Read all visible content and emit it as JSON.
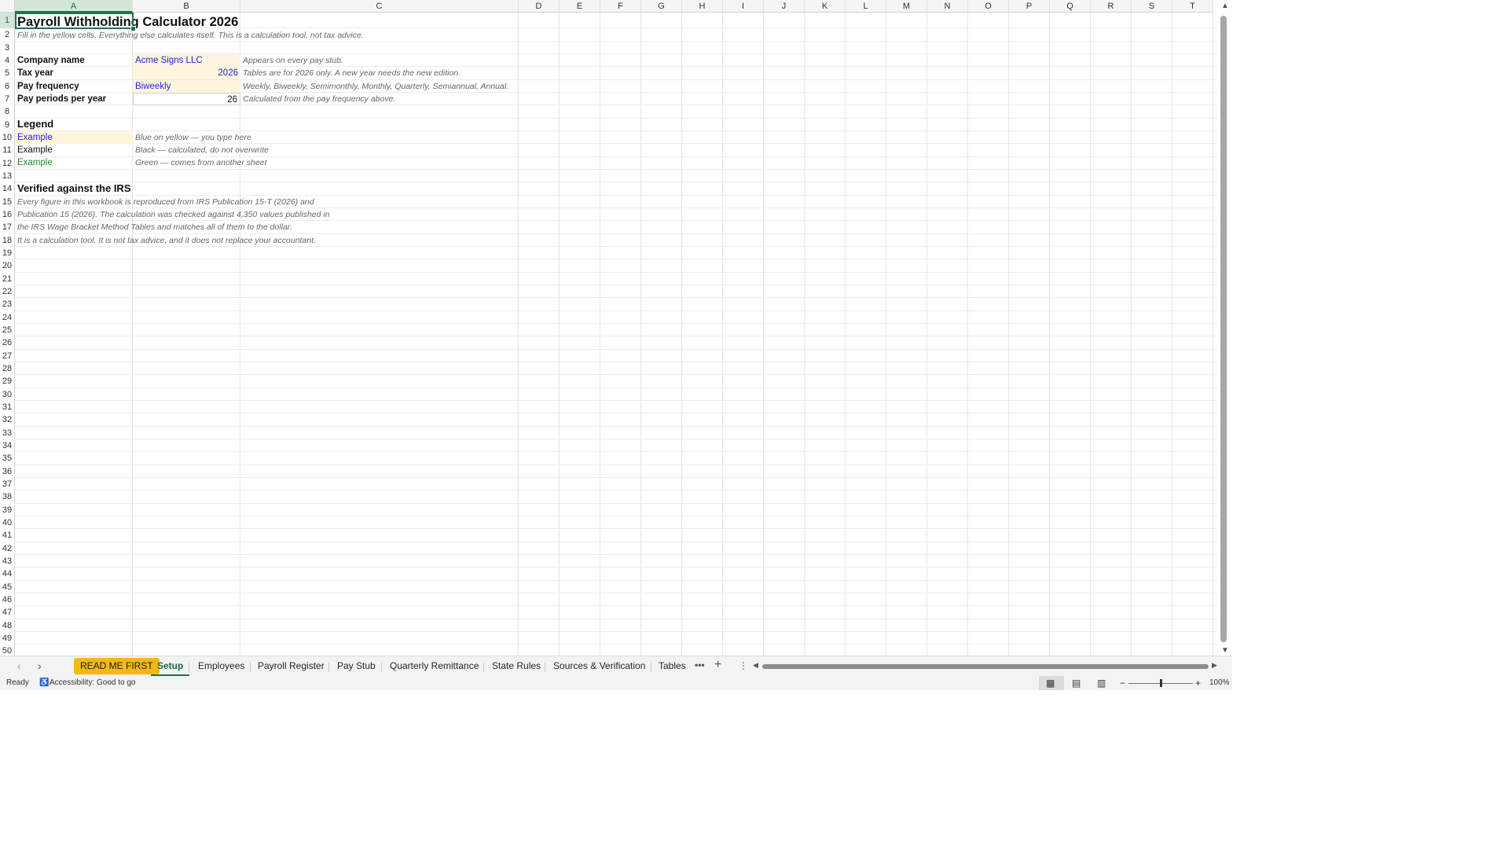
{
  "columns": [
    "A",
    "B",
    "C",
    "D",
    "E",
    "F",
    "G",
    "H",
    "I",
    "J",
    "K",
    "L",
    "M",
    "N",
    "O",
    "P",
    "Q",
    "R",
    "S",
    "T"
  ],
  "rows": [
    "1",
    "2",
    "3",
    "4",
    "5",
    "6",
    "7",
    "8",
    "9",
    "10",
    "11",
    "12",
    "13",
    "14",
    "15",
    "16",
    "17",
    "18",
    "19",
    "20",
    "21",
    "22",
    "23",
    "24",
    "25",
    "26",
    "27",
    "28",
    "29",
    "30",
    "31",
    "32",
    "33",
    "34",
    "35",
    "36",
    "37",
    "38",
    "39",
    "40",
    "41",
    "42",
    "43",
    "44",
    "45",
    "46",
    "47",
    "48",
    "49",
    "50"
  ],
  "cells": {
    "title": "Payroll Withholding Calculator 2026",
    "subtitle": "Fill in the yellow cells. Everything else calculates itself. This is a calculation tool, not tax advice.",
    "company_label": "Company name",
    "company_value": "Acme Signs LLC",
    "company_note": "Appears on every pay stub.",
    "taxyear_label": "Tax year",
    "taxyear_value": "2026",
    "taxyear_note": "Tables are for 2026 only. A new year needs the new edition.",
    "payfreq_label": "Pay frequency",
    "payfreq_value": "Biweekly",
    "payfreq_note": "Weekly, Biweekly, Semimonthly, Monthly, Quarterly, Semiannual, Annual.",
    "periods_label": "Pay periods per year",
    "periods_value": "26",
    "periods_note": "Calculated from the pay frequency above.",
    "legend_heading": "Legend",
    "legend1_example": "Example",
    "legend1_note": "Blue on yellow — you type here",
    "legend2_example": "Example",
    "legend2_note": "Black — calculated, do not overwrite",
    "legend3_example": "Example",
    "legend3_note": "Green — comes from another sheet",
    "verified_heading": "Verified against the IRS",
    "verified_line1": "Every figure in this workbook is reproduced from IRS Publication 15-T (2026) and",
    "verified_line2": "Publication 15 (2026). The calculation was checked against 4,350 values published in",
    "verified_line3": "the IRS Wage Bracket Method Tables and matches all of them to the dollar.",
    "verified_line4": "It is a calculation tool. It is not tax advice, and it does not replace your accountant."
  },
  "tabs": {
    "readme": "READ ME FIRST",
    "setup": "Setup",
    "employees": "Employees",
    "register": "Payroll Register",
    "paystub": "Pay Stub",
    "quarterly": "Quarterly Remittance",
    "staterules": "State Rules",
    "sources": "Sources & Verification",
    "tables": "Tables"
  },
  "status": {
    "ready": "Ready",
    "accessibility": "Accessibility: Good to go",
    "zoom": "100%"
  },
  "colors": {
    "accent": "#217346",
    "input_fill": "#fff5dd",
    "input_text": "#2323e6",
    "link_text": "#1e8a2e",
    "readme_tab": "#f5b914"
  }
}
